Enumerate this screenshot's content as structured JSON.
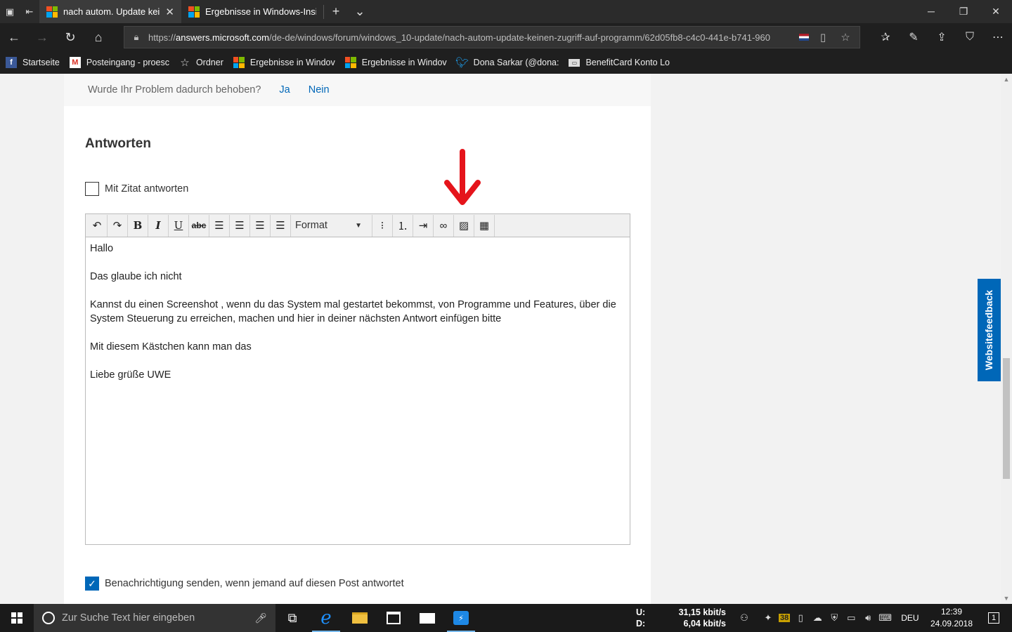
{
  "browser": {
    "tabs": [
      {
        "title": "nach autom. Update kei",
        "active": true
      },
      {
        "title": "Ergebnisse in Windows-Insi",
        "active": false
      }
    ],
    "url_prefix": "https://",
    "url_domain": "answers.microsoft.com",
    "url_path": "/de-de/windows/forum/windows_10-update/nach-autom-update-keinen-zugriff-auf-programm/62d05fb8-c4c0-441e-b741-960",
    "favorites": [
      {
        "label": "Startseite",
        "icon": "facebook-icon"
      },
      {
        "label": "Posteingang - proesc",
        "icon": "gmail-icon"
      },
      {
        "label": "Ordner",
        "icon": "star-icon"
      },
      {
        "label": "Ergebnisse in Windov",
        "icon": "microsoft-icon"
      },
      {
        "label": "Ergebnisse in Windov",
        "icon": "microsoft-icon"
      },
      {
        "label": "Dona Sarkar (@dona:",
        "icon": "twitter-icon"
      },
      {
        "label": "BenefitCard Konto Lo",
        "icon": "card-icon"
      }
    ]
  },
  "feedback": {
    "question": "Wurde Ihr Problem dadurch behoben?",
    "yes": "Ja",
    "no": "Nein"
  },
  "reply": {
    "heading": "Antworten",
    "quote_label": "Mit Zitat antworten",
    "quote_checked": false,
    "format_label": "Format",
    "body": [
      "Hallo",
      "Das glaube ich nicht",
      "Kannst du einen Screenshot , wenn du das System mal gestartet bekommst, von Programme und Features, über die System Steuerung zu erreichen, machen und hier in deiner nächsten Antwort einfügen bitte",
      "Mit diesem Kästchen kann man das",
      "Liebe grüße UWE"
    ],
    "notify_label": "Benachrichtigung senden, wenn jemand auf diesen Post antwortet",
    "notify_checked": true
  },
  "side_feedback": "Websitefeedback",
  "taskbar": {
    "search_placeholder": "Zur Suche Text hier eingeben",
    "net_up_label": "U:",
    "net_up": "31,15 kbit/s",
    "net_down_label": "D:",
    "net_down": "6,04 kbit/s",
    "tray_badge": "38",
    "language": "DEU",
    "time": "12:39",
    "date": "24.09.2018",
    "notification_count": "1"
  },
  "colors": {
    "accent": "#0067b8",
    "annotation_arrow": "#e5141b"
  }
}
